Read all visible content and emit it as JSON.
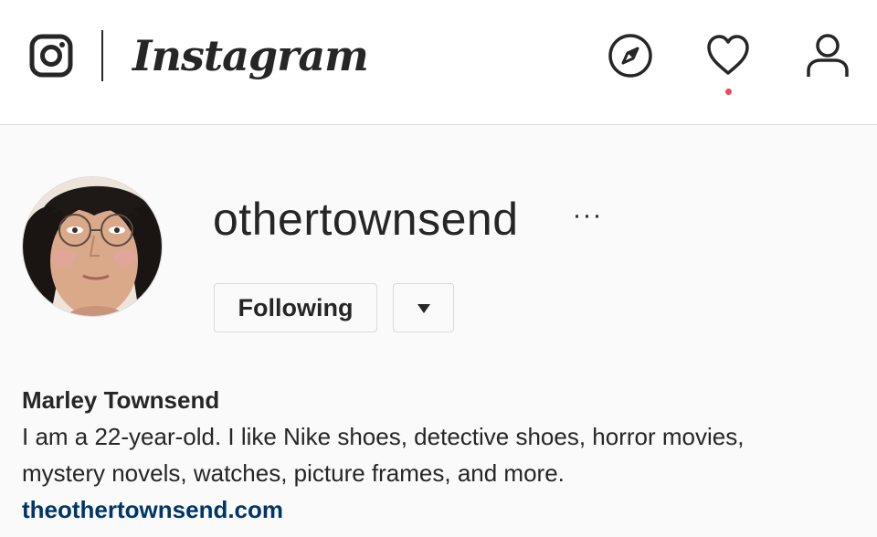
{
  "header": {
    "logo_icon": "instagram-glyph-icon",
    "wordmark": "Instagram",
    "nav_icons": [
      "explore-compass-icon",
      "activity-heart-icon",
      "profile-person-icon"
    ],
    "notification_dot_color": "#ed4956"
  },
  "profile": {
    "username": "othertownsend",
    "more_label": "···",
    "following_label": "Following",
    "dropdown_icon": "caret-down-icon",
    "full_name": "Marley Townsend",
    "bio_line1": "I am a 22-year-old. I like Nike shoes, detective shoes, horror movies,",
    "bio_line2": "mystery novels, watches, picture frames, and more.",
    "website": "theothertownsend.com"
  },
  "colors": {
    "background": "#fafafa",
    "text": "#262626",
    "link": "#003569",
    "border": "#dbdbdb"
  }
}
